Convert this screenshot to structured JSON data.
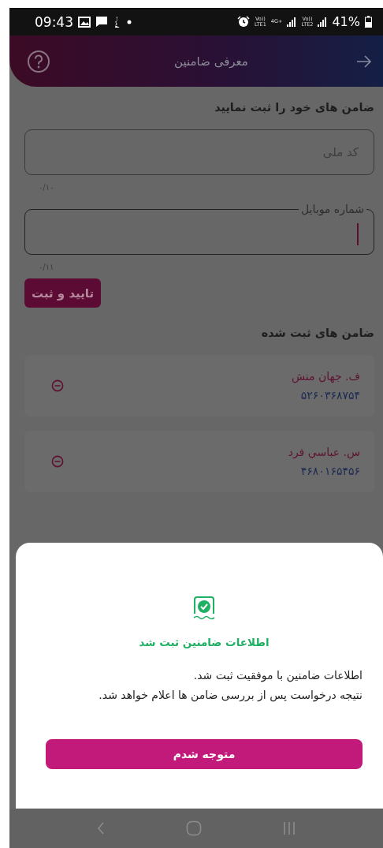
{
  "status_bar": {
    "time": "09:43",
    "network_labels": [
      "Vo))",
      "LTE1",
      "4G+",
      "Vo))",
      "LTE2"
    ],
    "battery": "41%"
  },
  "header": {
    "title": "معرفی ضامنین"
  },
  "form": {
    "heading": "ضامن های خود را ثبت نمایید",
    "fields": [
      {
        "placeholder": "کد ملی",
        "counter": "۰/۱۰",
        "focused": false
      },
      {
        "label": "شماره موبایل",
        "counter": "۰/۱۱",
        "focused": true
      }
    ],
    "submit_button": "تایید و ثبت"
  },
  "guarantors": {
    "heading": "ضامن های ثبت شده",
    "items": [
      {
        "name": "ف. جهان منش",
        "national_code": "۵۲۶۰۳۶۸۷۵۴"
      },
      {
        "name": "س. عباسي فرد",
        "national_code": "۴۶۸۰۱۶۵۴۵۶"
      }
    ]
  },
  "dialog": {
    "title": "اطلاعات ضامنین ثبت شد",
    "message_lines": [
      "اطلاعات ضامنین با موفقیت ثبت شد.",
      "نتیجه درخواست پس از بررسی ضامن ها اعلام خواهد شد."
    ],
    "button": "متوجه شدم"
  }
}
